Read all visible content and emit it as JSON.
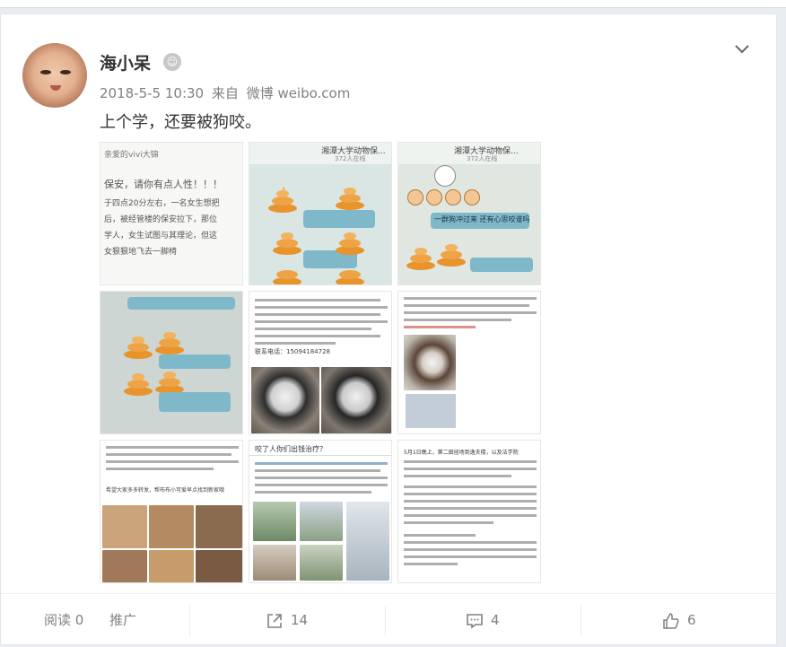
{
  "post": {
    "username": "海小呆",
    "badge_icon": "robot-badge-icon",
    "date": "2018-5-5 10:30",
    "from_label": "来自",
    "source": "微博 weibo.com",
    "text": "上个学，还要被狗咬。"
  },
  "thumbs": [
    {
      "name": "image-handwritten-note",
      "hw_title": "亲爱的vivi大锦",
      "hw_lines": [
        "保安，请你有点人性！！！",
        "于四点20分左右，一名女生想把",
        "后，被经管楼的保安拉下，那位",
        "学人，女生试图与其理论，但这",
        "女狠狠地飞去一脚椅"
      ]
    },
    {
      "name": "image-chat-screenshot-1",
      "header": "湘潭大学动物保...",
      "sub": "372人在线"
    },
    {
      "name": "image-chat-screenshot-2",
      "header": "湘潭大学动物保...",
      "sub": "372人在线",
      "bubble": "一群狗冲过来 还有心思咬谁吗"
    },
    {
      "name": "image-chat-screenshot-3"
    },
    {
      "name": "image-dog-adoption-post",
      "phone": "联系电话：15094184728"
    },
    {
      "name": "image-dog-notice"
    },
    {
      "name": "image-dog-photos-collage",
      "tail": "希望大家多多转发，帮布布小可爱早点找到新家哦"
    },
    {
      "name": "image-social-post",
      "question": "咬了人你们出钱治疗？"
    },
    {
      "name": "image-safety-notice",
      "head": "5月1日晚上，第二田径场到逸夫楼，以及法学院"
    }
  ],
  "footer": {
    "read_label": "阅读",
    "read_count": "0",
    "promote_label": "推广",
    "share_count": "14",
    "comment_count": "4",
    "like_count": "6"
  },
  "colors": {
    "accent": "#ff8200",
    "text_main": "#333333",
    "text_meta": "#808080",
    "poop": "#e8932b"
  }
}
